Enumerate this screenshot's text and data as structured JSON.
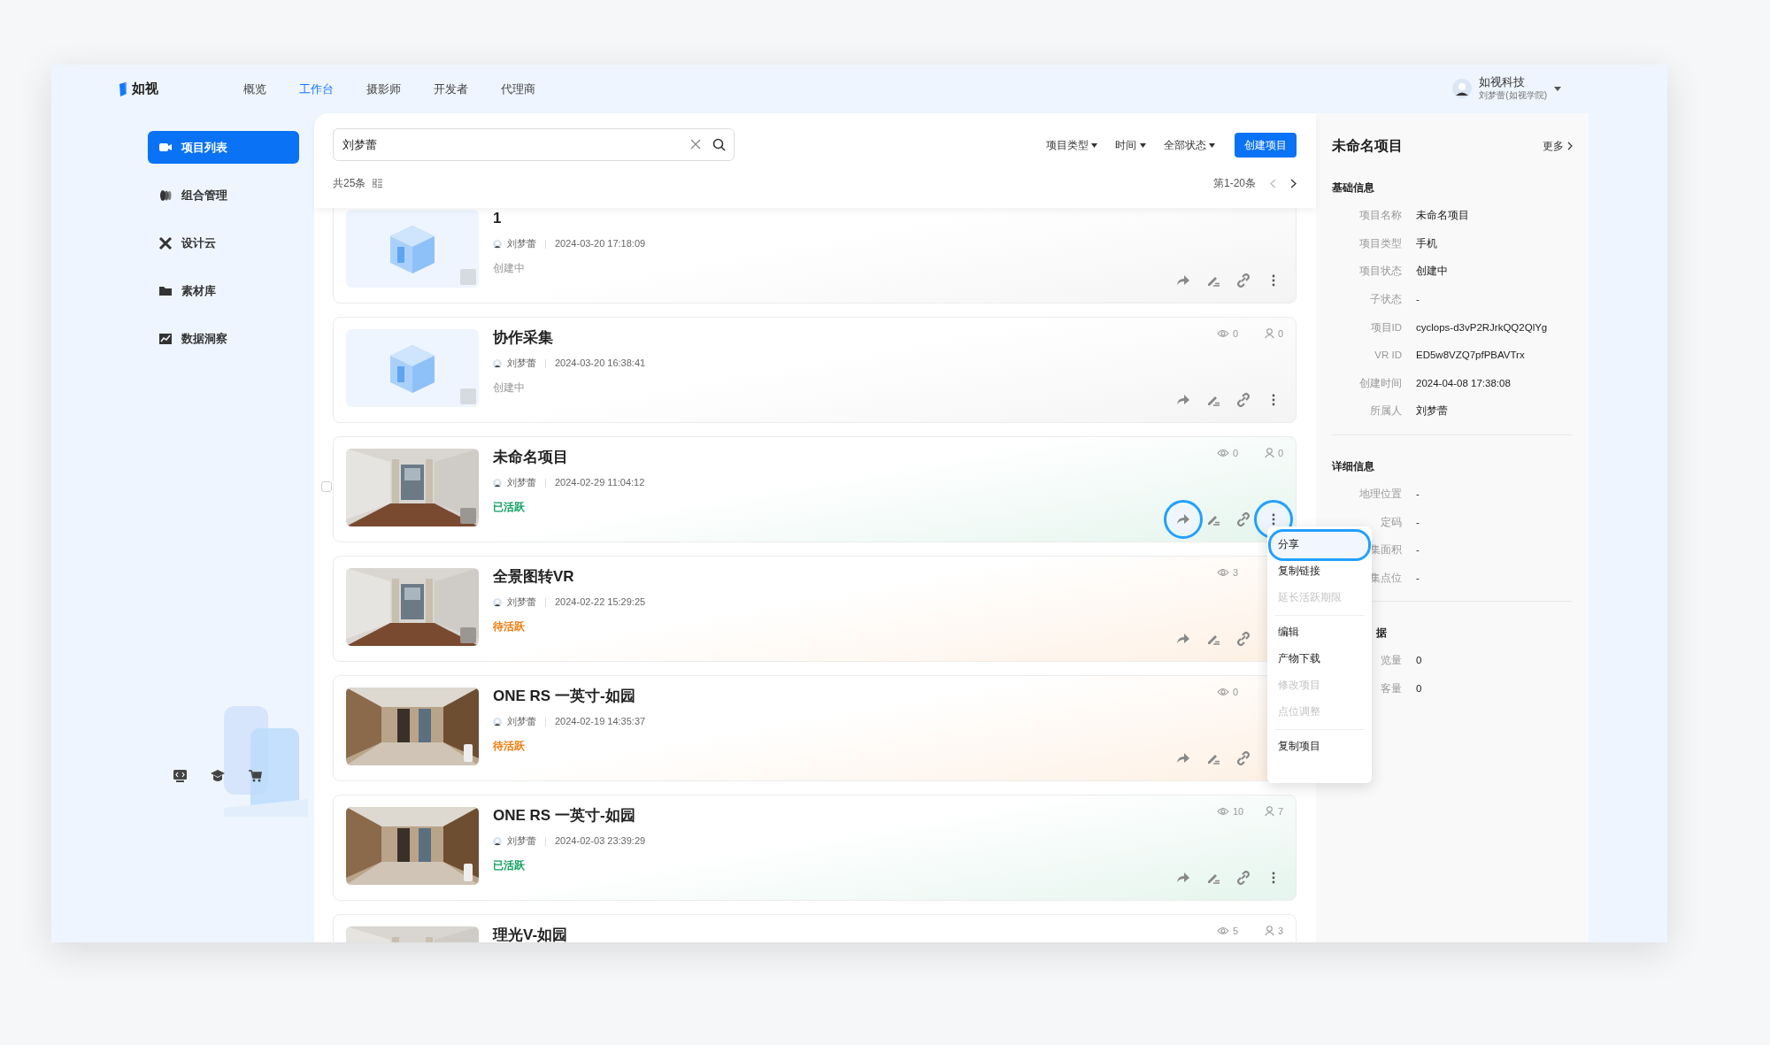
{
  "topbar": {
    "logo": "如视",
    "tabs": [
      {
        "label": "概览",
        "selected": false
      },
      {
        "label": "工作台",
        "selected": true
      },
      {
        "label": "摄影师",
        "selected": false
      },
      {
        "label": "开发者",
        "selected": false
      },
      {
        "label": "代理商",
        "selected": false
      }
    ],
    "user": {
      "company": "如视科技",
      "name": "刘梦蕾(如视学院)"
    }
  },
  "sidebar": {
    "items": [
      {
        "label": "项目列表",
        "selected": true
      },
      {
        "label": "组合管理",
        "selected": false
      },
      {
        "label": "设计云",
        "selected": false
      },
      {
        "label": "素材库",
        "selected": false
      },
      {
        "label": "数据洞察",
        "selected": false
      }
    ]
  },
  "toolbar": {
    "search": {
      "value": "刘梦蕾"
    },
    "filters": [
      "项目类型",
      "时间",
      "全部状态"
    ],
    "create_button": "创建项目",
    "total": "共25条",
    "range": "第1-20条"
  },
  "projects": [
    {
      "title": "1",
      "owner": "刘梦蕾",
      "time": "2024-03-20 17:18:09",
      "status": "创建中",
      "color": "#999999",
      "kind": "placeholder",
      "selected": false,
      "covered": false
    },
    {
      "title": "协作采集",
      "owner": "刘梦蕾",
      "time": "2024-03-20 16:38:41",
      "status": "创建中",
      "color": "#999999",
      "kind": "placeholder",
      "views": "0",
      "users": "0",
      "selected": false,
      "covered": false
    },
    {
      "title": "未命名项目",
      "owner": "刘梦蕾",
      "time": "2024-02-29 11:04:12",
      "status": "已活跃",
      "color": "#10a060",
      "views": "0",
      "users": "0",
      "selected": true,
      "covered": false
    },
    {
      "title": "全景图转VR",
      "owner": "刘梦蕾",
      "time": "2024-02-22 15:29:25",
      "status": "待活跃",
      "color": "#f07a0a",
      "views": "3",
      "selected": false,
      "covered": true
    },
    {
      "title": "ONE RS 一英寸-如园",
      "owner": "刘梦蕾",
      "time": "2024-02-19 14:35:37",
      "status": "待活跃",
      "color": "#f07a0a",
      "views": "0",
      "selected": false,
      "covered": true
    },
    {
      "title": "ONE RS 一英寸-如园",
      "owner": "刘梦蕾",
      "time": "2024-02-03 23:39:29",
      "status": "已活跃",
      "color": "#10a060",
      "views": "10",
      "users": "7",
      "selected": false,
      "covered": false
    },
    {
      "title": "理光V-如园",
      "views": "5",
      "users": "3",
      "selected": false,
      "covered": false
    }
  ],
  "menu": {
    "groups": [
      [
        {
          "label": "分享",
          "disabled": false,
          "selected": true
        },
        {
          "label": "复制链接",
          "disabled": false,
          "selected": false
        },
        {
          "label": "延长活跃期限",
          "disabled": true,
          "selected": false
        }
      ],
      [
        {
          "label": "编辑",
          "disabled": false,
          "selected": false
        },
        {
          "label": "产物下载",
          "disabled": false,
          "selected": false
        },
        {
          "label": "修改项目",
          "disabled": true,
          "selected": false
        },
        {
          "label": "点位调整",
          "disabled": true,
          "selected": false
        }
      ],
      [
        {
          "label": "复制项目",
          "disabled": false,
          "selected": false
        }
      ]
    ]
  },
  "detail": {
    "title": "未命名项目",
    "more": "更多",
    "sections": [
      {
        "title": "基础信息",
        "rows": [
          {
            "label": "项目名称",
            "value": "未命名项目"
          },
          {
            "label": "项目类型",
            "value": "手机"
          },
          {
            "label": "项目状态",
            "value": "创建中"
          },
          {
            "label": "子状态",
            "value": "-"
          },
          {
            "label": "项目ID",
            "value": "cyclops-d3vP2RJrkQQ2QlYg"
          },
          {
            "label": "VR ID",
            "value": "ED5w8VZQ7pfPBAVTrx"
          },
          {
            "label": "创建时间",
            "value": "2024-04-08 17:38:08"
          },
          {
            "label": "所属人",
            "value": "刘梦蕾"
          }
        ]
      },
      {
        "title": "详细信息",
        "rows": [
          {
            "label": "地理位置",
            "value": "-"
          },
          {
            "label": "定码",
            "value": "-"
          },
          {
            "label": "集面积",
            "value": "-"
          },
          {
            "label": "集点位",
            "value": "-"
          }
        ]
      },
      {
        "title": "据",
        "rows": [
          {
            "label": "览量",
            "value": "0"
          },
          {
            "label": "客量",
            "value": "0"
          }
        ]
      }
    ]
  }
}
